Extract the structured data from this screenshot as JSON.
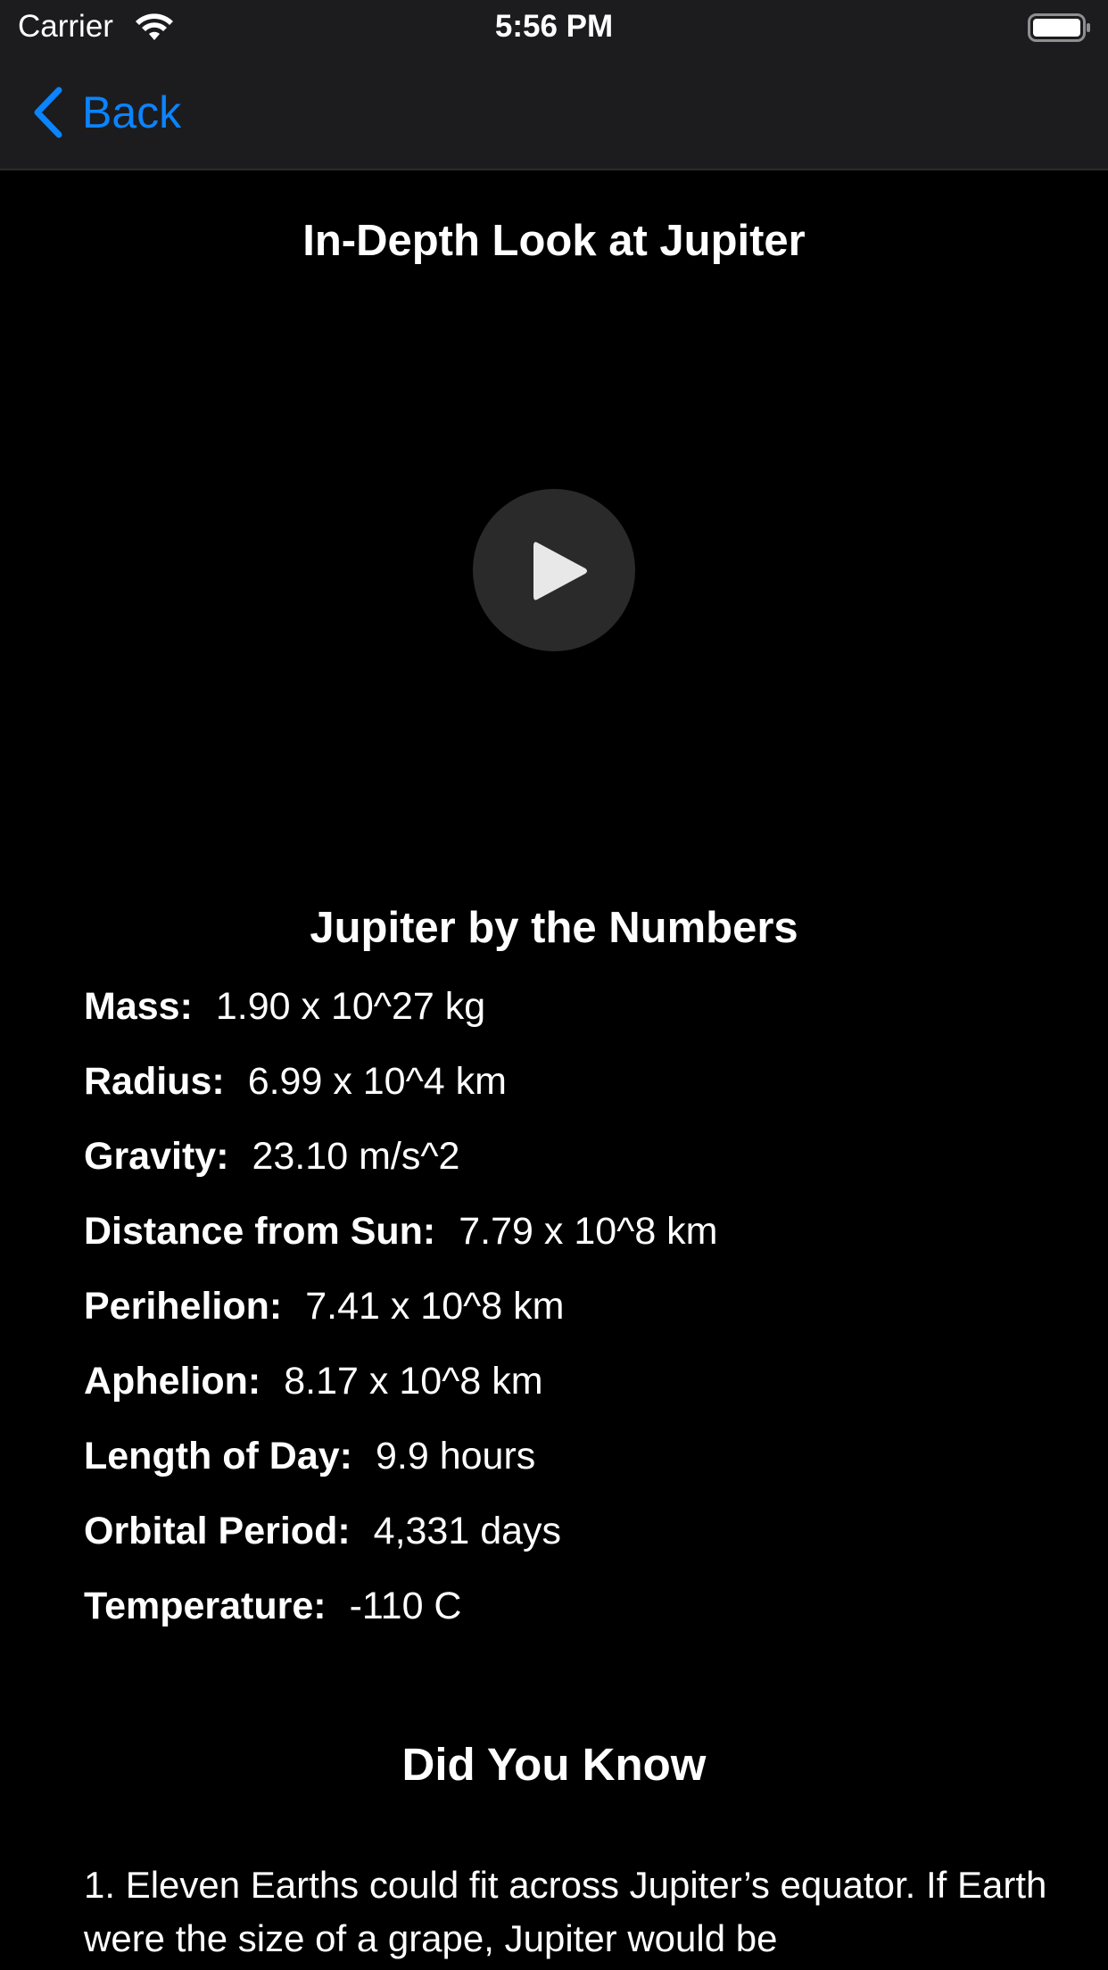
{
  "status_bar": {
    "carrier": "Carrier",
    "time": "5:56 PM",
    "wifi_icon": "wifi-icon",
    "battery_icon": "battery-icon"
  },
  "nav": {
    "back_label": "Back",
    "back_icon": "chevron-left-icon",
    "accent_color": "#0a84ff"
  },
  "page": {
    "title": "In-Depth Look at Jupiter"
  },
  "video": {
    "play_icon": "play-icon"
  },
  "numbers": {
    "title": "Jupiter by the Numbers",
    "stats": [
      {
        "label": "Mass:",
        "value": "1.90 x 10^27 kg"
      },
      {
        "label": "Radius:",
        "value": "6.99 x 10^4 km"
      },
      {
        "label": "Gravity:",
        "value": "23.10 m/s^2"
      },
      {
        "label": "Distance from Sun:",
        "value": "7.79 x 10^8 km"
      },
      {
        "label": "Perihelion:",
        "value": "7.41 x 10^8 km"
      },
      {
        "label": "Aphelion:",
        "value": "8.17 x 10^8 km"
      },
      {
        "label": "Length of Day:",
        "value": "9.9 hours"
      },
      {
        "label": "Orbital Period:",
        "value": "4,331 days"
      },
      {
        "label": "Temperature:",
        "value": "-110 C"
      }
    ]
  },
  "did_you_know": {
    "title": "Did You Know",
    "fact": "1. Eleven Earths could fit across Jupiter’s equator. If Earth were the size of a grape, Jupiter would be"
  }
}
